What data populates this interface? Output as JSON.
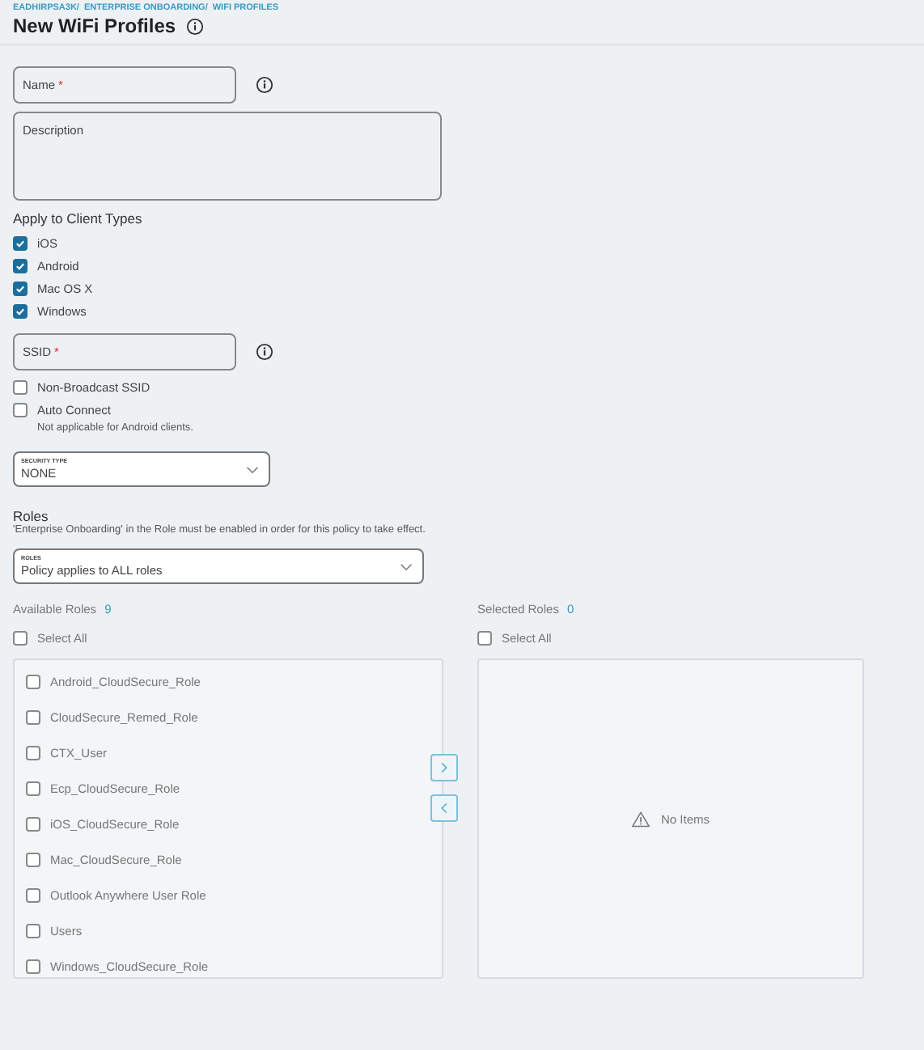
{
  "breadcrumb": [
    "EADHIRPSA3K/",
    "ENTERPRISE ONBOARDING/",
    "WIFI PROFILES"
  ],
  "title": "New WiFi Profiles",
  "name_field": {
    "placeholder": "Name",
    "required_mark": "*"
  },
  "description_field": {
    "placeholder": "Description"
  },
  "client_types": {
    "heading": "Apply to Client Types",
    "items": [
      {
        "label": "iOS",
        "checked": true
      },
      {
        "label": "Android",
        "checked": true
      },
      {
        "label": "Mac OS X",
        "checked": true
      },
      {
        "label": "Windows",
        "checked": true
      }
    ]
  },
  "ssid_field": {
    "placeholder": "SSID",
    "required_mark": "*"
  },
  "ssid_options": [
    {
      "label": "Non-Broadcast SSID",
      "checked": false
    },
    {
      "label": "Auto Connect",
      "checked": false
    }
  ],
  "auto_connect_note": "Not applicable for Android clients.",
  "security_type": {
    "label": "SECURITY TYPE",
    "value": "NONE"
  },
  "roles": {
    "heading": "Roles",
    "note": "'Enterprise Onboarding' in the Role must be enabled in order for this policy to take effect.",
    "select": {
      "label": "ROLES",
      "value": "Policy applies to ALL roles"
    }
  },
  "available_roles": {
    "heading": "Available Roles",
    "count": "9",
    "select_all": {
      "label": "Select All",
      "checked": false
    },
    "items": [
      {
        "label": "Android_CloudSecure_Role",
        "checked": false
      },
      {
        "label": "CloudSecure_Remed_Role",
        "checked": false
      },
      {
        "label": "CTX_User",
        "checked": false
      },
      {
        "label": "Ecp_CloudSecure_Role",
        "checked": false
      },
      {
        "label": "iOS_CloudSecure_Role",
        "checked": false
      },
      {
        "label": "Mac_CloudSecure_Role",
        "checked": false
      },
      {
        "label": "Outlook Anywhere User Role",
        "checked": false
      },
      {
        "label": "Users",
        "checked": false
      },
      {
        "label": "Windows_CloudSecure_Role",
        "checked": false
      }
    ]
  },
  "selected_roles": {
    "heading": "Selected Roles",
    "count": "0",
    "select_all": {
      "label": "Select All",
      "checked": false
    },
    "empty_text": "No Items"
  }
}
